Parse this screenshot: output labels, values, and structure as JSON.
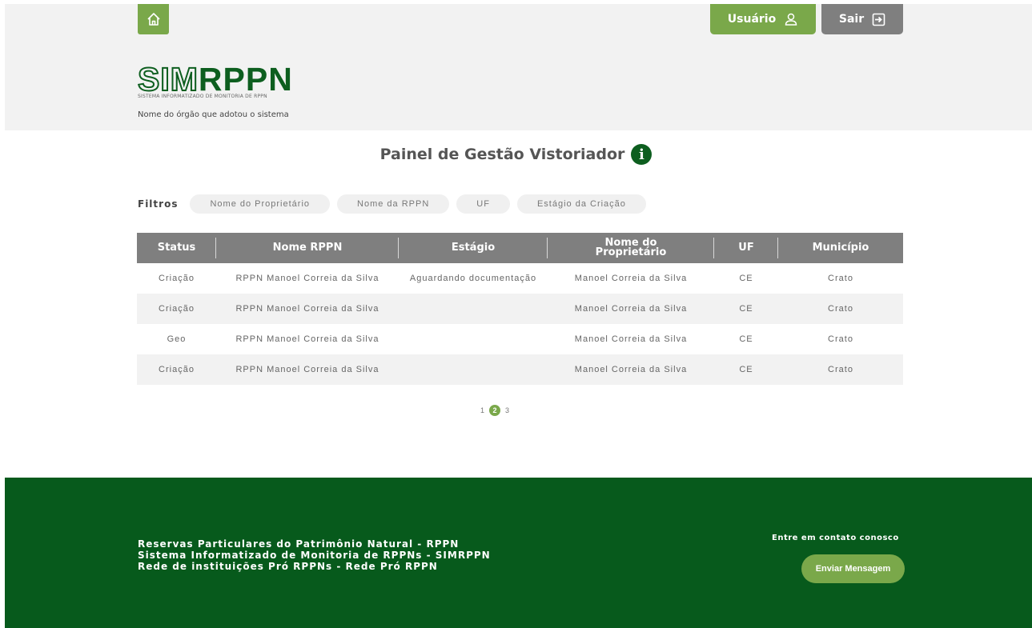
{
  "header": {
    "home_icon": "home-icon",
    "user_label": "Usuário",
    "user_icon": "user-icon",
    "exit_label": "Sair",
    "exit_icon": "exit-icon",
    "logo_sim": "SIM",
    "logo_rppn": "RPPN",
    "logo_subtitle": "SISTEMA INFORMATIZADO DE MONITORIA DE RPPN",
    "org_name": "Nome do órgão que adotou o sistema"
  },
  "panel": {
    "title": "Painel de Gestão Vistoriador",
    "info_icon": "info-icon"
  },
  "filters": {
    "label": "Filtros",
    "chips": [
      "Nome do Proprietário",
      "Nome da RPPN",
      "UF",
      "Estágio da Criação"
    ]
  },
  "table": {
    "headers": [
      "Status",
      "Nome RPPN",
      "Estágio",
      "Nome do Proprietário",
      "UF",
      "Município"
    ],
    "rows": [
      [
        "Criação",
        "RPPN Manoel Correia da Silva",
        "Aguardando documentação",
        "Manoel Correia da Silva",
        "CE",
        "Crato"
      ],
      [
        "Criação",
        "RPPN Manoel Correia da Silva",
        "",
        "Manoel Correia da Silva",
        "CE",
        "Crato"
      ],
      [
        "Geo",
        "RPPN Manoel Correia da Silva",
        "",
        "Manoel Correia da Silva",
        "CE",
        "Crato"
      ],
      [
        "Criação",
        "RPPN Manoel Correia da Silva",
        "",
        "Manoel Correia da Silva",
        "CE",
        "Crato"
      ]
    ]
  },
  "pagination": {
    "pages": [
      "1",
      "2",
      "3"
    ],
    "current": "2"
  },
  "footer": {
    "lines": [
      "Reservas Particulares do Patrimônio Natural - RPPN",
      "Sistema Informatizado de Monitoria de RPPNs - SIMRPPN",
      "Rede de instituições Pró RPPNs - Rede Pró RPPN"
    ],
    "contact_label": "Entre em contato conosco",
    "send_button": "Enviar Mensagem"
  },
  "colors": {
    "accent_green": "#7aa84a",
    "dark_green": "#075a1c",
    "gray_button": "#7f7f7f"
  }
}
